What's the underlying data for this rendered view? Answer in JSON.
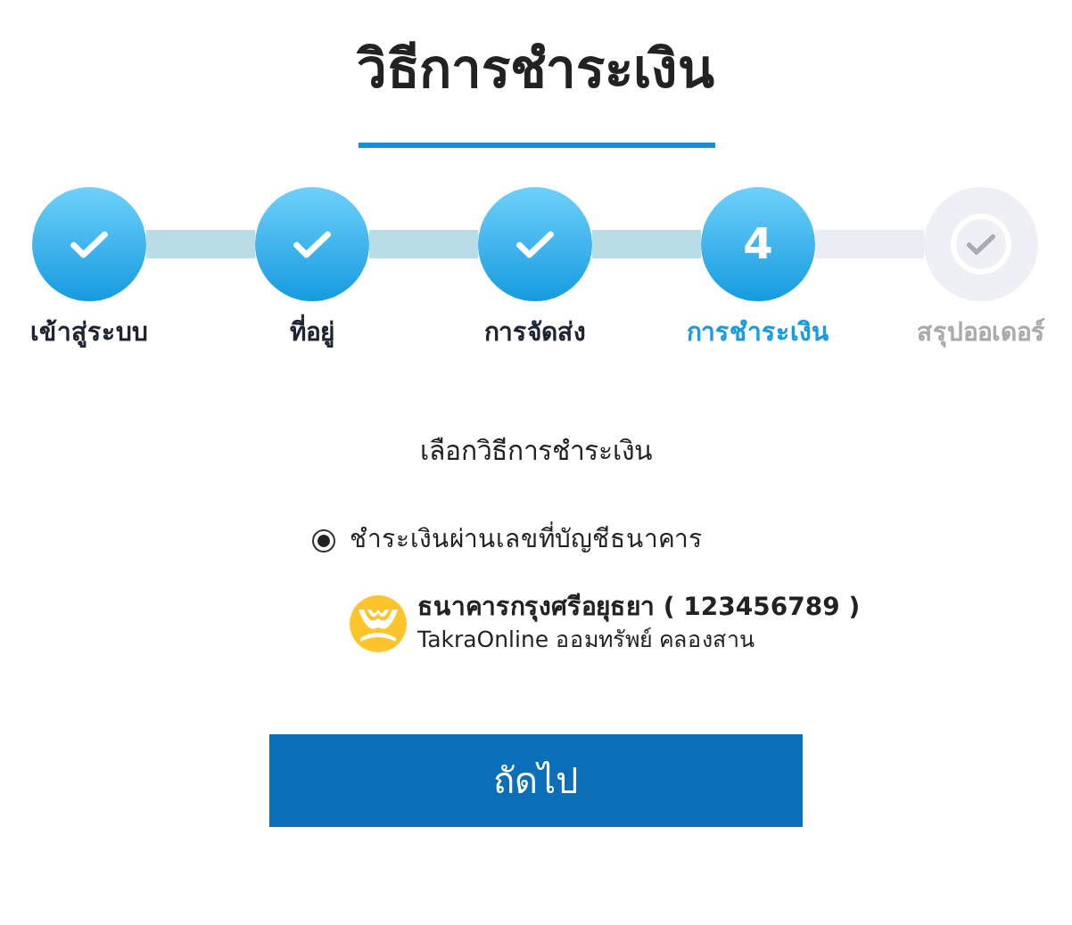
{
  "title": "วิธีการชำระเงิน",
  "steps": [
    {
      "label": "เข้าสู่ระบบ",
      "completed": true,
      "current": false
    },
    {
      "label": "ที่อยู่",
      "completed": true,
      "current": false
    },
    {
      "label": "การจัดส่ง",
      "completed": true,
      "current": false
    },
    {
      "label": "การชำระเงิน",
      "number": "4",
      "completed": false,
      "current": true
    },
    {
      "label": "สรุปออเดอร์",
      "completed": false,
      "current": false
    }
  ],
  "section_heading": "เลือกวิธีการชำระเงิน",
  "payment_options": [
    {
      "label": "ชำระเงินผ่านเลขที่บัญชีธนาคาร",
      "selected": true
    }
  ],
  "bank": {
    "name": "ธนาคารกรุงศรีอยุธยา ( 123456789 )",
    "details": "TakraOnline ออมทรัพย์ คลองสาน"
  },
  "next_button": "ถัดไป"
}
